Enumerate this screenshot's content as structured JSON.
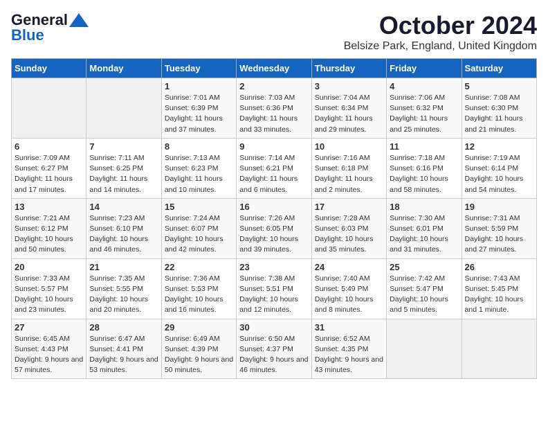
{
  "logo": {
    "line1": "General",
    "line2": "Blue"
  },
  "header": {
    "title": "October 2024",
    "location": "Belsize Park, England, United Kingdom"
  },
  "weekdays": [
    "Sunday",
    "Monday",
    "Tuesday",
    "Wednesday",
    "Thursday",
    "Friday",
    "Saturday"
  ],
  "weeks": [
    [
      {
        "day": "",
        "sunrise": "",
        "sunset": "",
        "daylight": ""
      },
      {
        "day": "",
        "sunrise": "",
        "sunset": "",
        "daylight": ""
      },
      {
        "day": "1",
        "sunrise": "Sunrise: 7:01 AM",
        "sunset": "Sunset: 6:39 PM",
        "daylight": "Daylight: 11 hours and 37 minutes."
      },
      {
        "day": "2",
        "sunrise": "Sunrise: 7:03 AM",
        "sunset": "Sunset: 6:36 PM",
        "daylight": "Daylight: 11 hours and 33 minutes."
      },
      {
        "day": "3",
        "sunrise": "Sunrise: 7:04 AM",
        "sunset": "Sunset: 6:34 PM",
        "daylight": "Daylight: 11 hours and 29 minutes."
      },
      {
        "day": "4",
        "sunrise": "Sunrise: 7:06 AM",
        "sunset": "Sunset: 6:32 PM",
        "daylight": "Daylight: 11 hours and 25 minutes."
      },
      {
        "day": "5",
        "sunrise": "Sunrise: 7:08 AM",
        "sunset": "Sunset: 6:30 PM",
        "daylight": "Daylight: 11 hours and 21 minutes."
      }
    ],
    [
      {
        "day": "6",
        "sunrise": "Sunrise: 7:09 AM",
        "sunset": "Sunset: 6:27 PM",
        "daylight": "Daylight: 11 hours and 17 minutes."
      },
      {
        "day": "7",
        "sunrise": "Sunrise: 7:11 AM",
        "sunset": "Sunset: 6:25 PM",
        "daylight": "Daylight: 11 hours and 14 minutes."
      },
      {
        "day": "8",
        "sunrise": "Sunrise: 7:13 AM",
        "sunset": "Sunset: 6:23 PM",
        "daylight": "Daylight: 11 hours and 10 minutes."
      },
      {
        "day": "9",
        "sunrise": "Sunrise: 7:14 AM",
        "sunset": "Sunset: 6:21 PM",
        "daylight": "Daylight: 11 hours and 6 minutes."
      },
      {
        "day": "10",
        "sunrise": "Sunrise: 7:16 AM",
        "sunset": "Sunset: 6:18 PM",
        "daylight": "Daylight: 11 hours and 2 minutes."
      },
      {
        "day": "11",
        "sunrise": "Sunrise: 7:18 AM",
        "sunset": "Sunset: 6:16 PM",
        "daylight": "Daylight: 10 hours and 58 minutes."
      },
      {
        "day": "12",
        "sunrise": "Sunrise: 7:19 AM",
        "sunset": "Sunset: 6:14 PM",
        "daylight": "Daylight: 10 hours and 54 minutes."
      }
    ],
    [
      {
        "day": "13",
        "sunrise": "Sunrise: 7:21 AM",
        "sunset": "Sunset: 6:12 PM",
        "daylight": "Daylight: 10 hours and 50 minutes."
      },
      {
        "day": "14",
        "sunrise": "Sunrise: 7:23 AM",
        "sunset": "Sunset: 6:10 PM",
        "daylight": "Daylight: 10 hours and 46 minutes."
      },
      {
        "day": "15",
        "sunrise": "Sunrise: 7:24 AM",
        "sunset": "Sunset: 6:07 PM",
        "daylight": "Daylight: 10 hours and 42 minutes."
      },
      {
        "day": "16",
        "sunrise": "Sunrise: 7:26 AM",
        "sunset": "Sunset: 6:05 PM",
        "daylight": "Daylight: 10 hours and 39 minutes."
      },
      {
        "day": "17",
        "sunrise": "Sunrise: 7:28 AM",
        "sunset": "Sunset: 6:03 PM",
        "daylight": "Daylight: 10 hours and 35 minutes."
      },
      {
        "day": "18",
        "sunrise": "Sunrise: 7:30 AM",
        "sunset": "Sunset: 6:01 PM",
        "daylight": "Daylight: 10 hours and 31 minutes."
      },
      {
        "day": "19",
        "sunrise": "Sunrise: 7:31 AM",
        "sunset": "Sunset: 5:59 PM",
        "daylight": "Daylight: 10 hours and 27 minutes."
      }
    ],
    [
      {
        "day": "20",
        "sunrise": "Sunrise: 7:33 AM",
        "sunset": "Sunset: 5:57 PM",
        "daylight": "Daylight: 10 hours and 23 minutes."
      },
      {
        "day": "21",
        "sunrise": "Sunrise: 7:35 AM",
        "sunset": "Sunset: 5:55 PM",
        "daylight": "Daylight: 10 hours and 20 minutes."
      },
      {
        "day": "22",
        "sunrise": "Sunrise: 7:36 AM",
        "sunset": "Sunset: 5:53 PM",
        "daylight": "Daylight: 10 hours and 16 minutes."
      },
      {
        "day": "23",
        "sunrise": "Sunrise: 7:38 AM",
        "sunset": "Sunset: 5:51 PM",
        "daylight": "Daylight: 10 hours and 12 minutes."
      },
      {
        "day": "24",
        "sunrise": "Sunrise: 7:40 AM",
        "sunset": "Sunset: 5:49 PM",
        "daylight": "Daylight: 10 hours and 8 minutes."
      },
      {
        "day": "25",
        "sunrise": "Sunrise: 7:42 AM",
        "sunset": "Sunset: 5:47 PM",
        "daylight": "Daylight: 10 hours and 5 minutes."
      },
      {
        "day": "26",
        "sunrise": "Sunrise: 7:43 AM",
        "sunset": "Sunset: 5:45 PM",
        "daylight": "Daylight: 10 hours and 1 minute."
      }
    ],
    [
      {
        "day": "27",
        "sunrise": "Sunrise: 6:45 AM",
        "sunset": "Sunset: 4:43 PM",
        "daylight": "Daylight: 9 hours and 57 minutes."
      },
      {
        "day": "28",
        "sunrise": "Sunrise: 6:47 AM",
        "sunset": "Sunset: 4:41 PM",
        "daylight": "Daylight: 9 hours and 53 minutes."
      },
      {
        "day": "29",
        "sunrise": "Sunrise: 6:49 AM",
        "sunset": "Sunset: 4:39 PM",
        "daylight": "Daylight: 9 hours and 50 minutes."
      },
      {
        "day": "30",
        "sunrise": "Sunrise: 6:50 AM",
        "sunset": "Sunset: 4:37 PM",
        "daylight": "Daylight: 9 hours and 46 minutes."
      },
      {
        "day": "31",
        "sunrise": "Sunrise: 6:52 AM",
        "sunset": "Sunset: 4:35 PM",
        "daylight": "Daylight: 9 hours and 43 minutes."
      },
      {
        "day": "",
        "sunrise": "",
        "sunset": "",
        "daylight": ""
      },
      {
        "day": "",
        "sunrise": "",
        "sunset": "",
        "daylight": ""
      }
    ]
  ]
}
